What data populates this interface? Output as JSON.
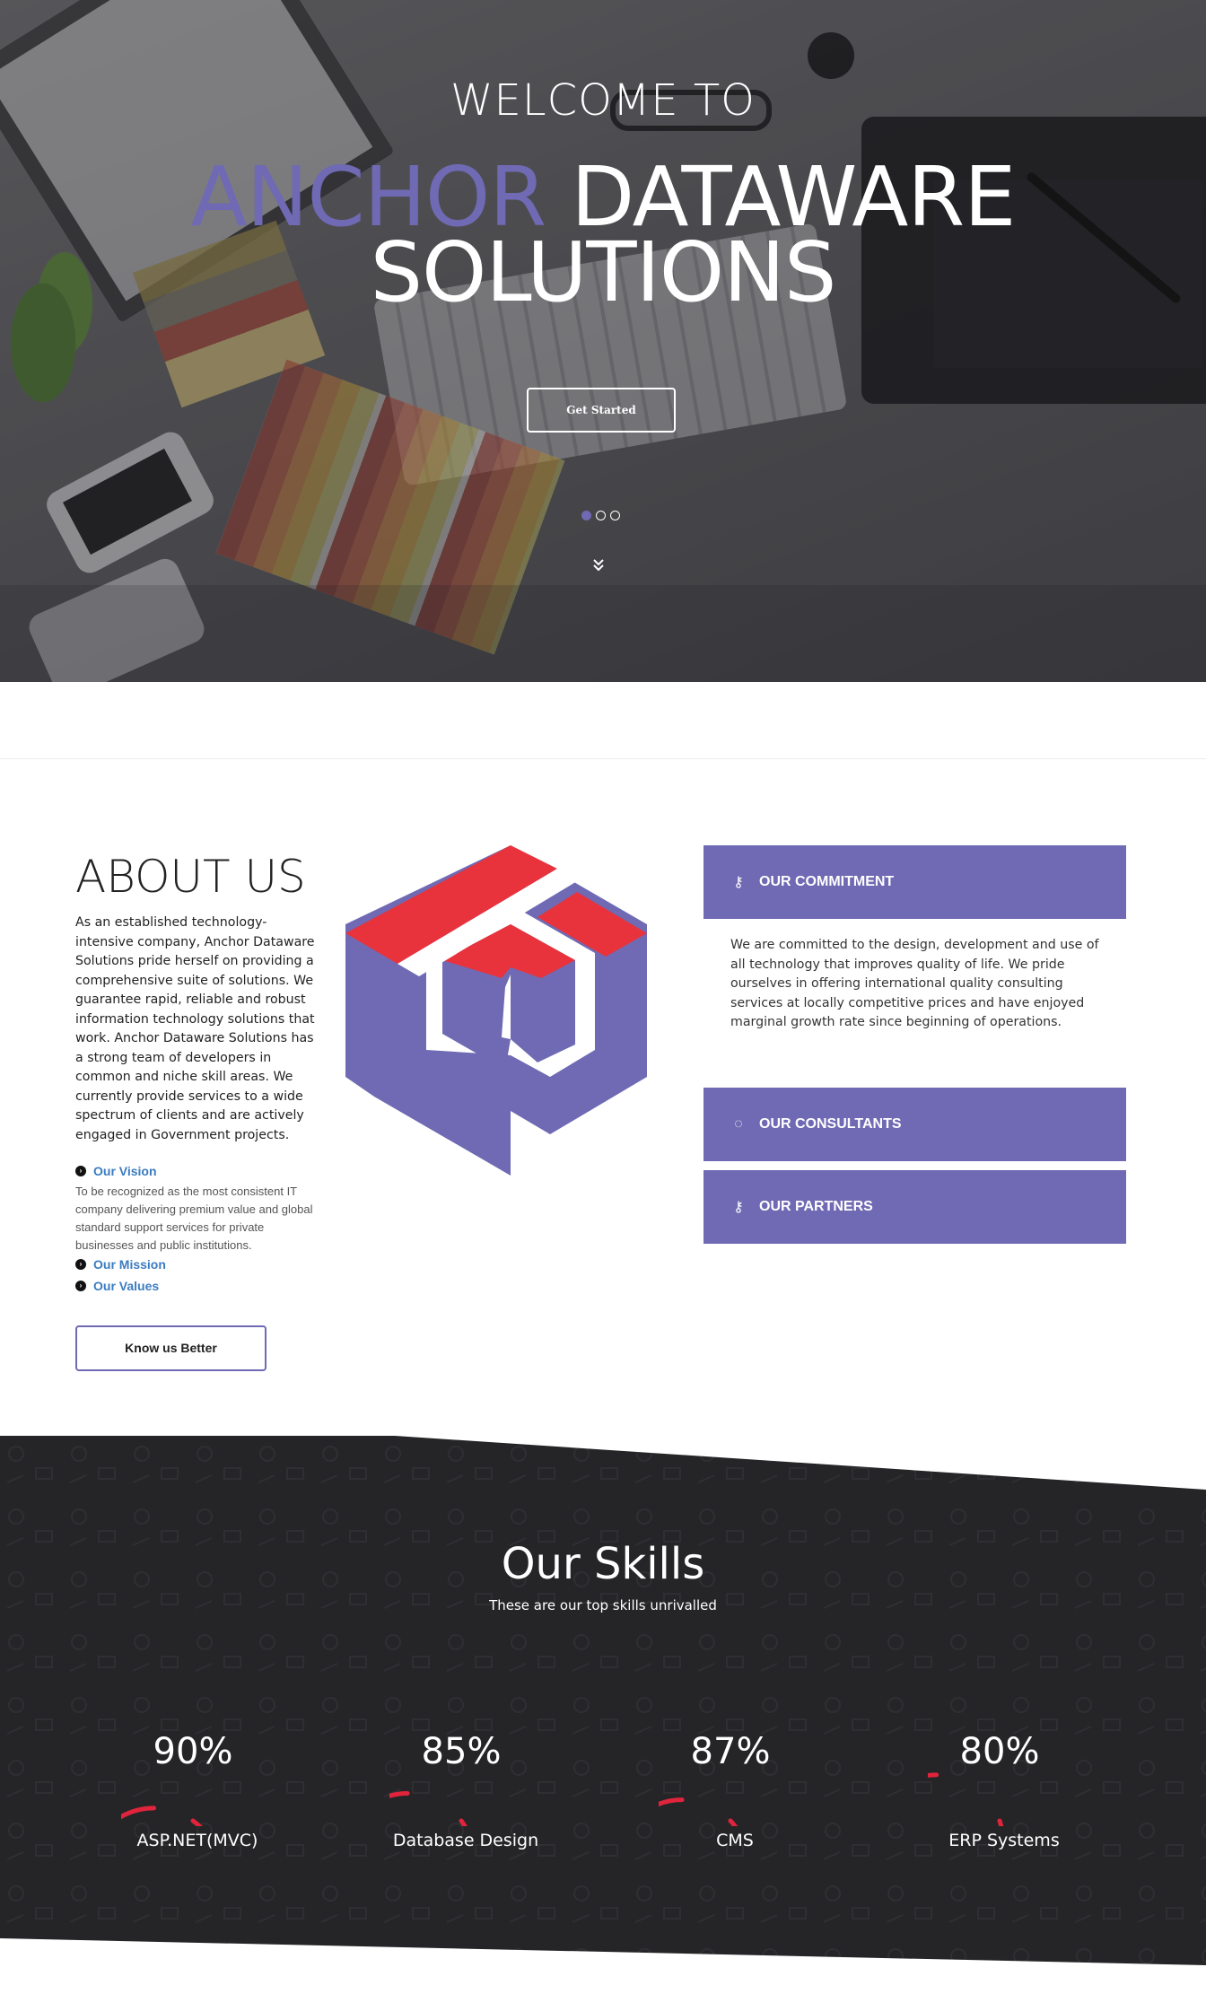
{
  "hero": {
    "welcome": "WELCOME TO",
    "title_accent": "ANCHOR",
    "title_rest": "DATAWARE",
    "title_line2": "SOLUTIONS",
    "cta_label": "Get Started",
    "accent_color": "#6f6ab3",
    "slides_total": 3,
    "slide_active": 1
  },
  "about": {
    "title": "ABOUT US",
    "body": "As an established technology-intensive company, Anchor Dataware Solutions pride herself on providing a comprehensive suite of solutions. We guarantee rapid, reliable and robust information technology solutions that work. Anchor Dataware Solutions has a strong team of developers in common and niche skill areas. We currently provide services to a wide spectrum of clients and are actively engaged in Government projects.",
    "vision_label": "Our Vision",
    "vision_text": "To be recognized as the most consistent IT company delivering premium value and global standard support services for private businesses and public institutions.",
    "mission_label": "Our Mission",
    "values_label": "Our Values",
    "button_label": "Know us Better"
  },
  "panels": {
    "commitment_title": "OUR COMMITMENT",
    "commitment_body": "We are committed to the design, development and use of all technology that improves quality of life. We pride ourselves in offering international quality consulting services at locally competitive prices and have enjoyed marginal growth rate since beginning of operations.",
    "consultants_title": "OUR CONSULTANTS",
    "partners_title": "OUR PARTNERS",
    "panel_color": "#6f6ab3"
  },
  "skills": {
    "title": "Our Skills",
    "subtitle": "These are our top skills unrivalled",
    "ring_color": "#e0243c",
    "items": [
      {
        "pct": "90%",
        "value": 90,
        "label": "ASP.NET(MVC)"
      },
      {
        "pct": "85%",
        "value": 85,
        "label": "Database Design"
      },
      {
        "pct": "87%",
        "value": 87,
        "label": "CMS"
      },
      {
        "pct": "80%",
        "value": 80,
        "label": "ERP Systems"
      }
    ]
  },
  "logo": {
    "red": "#e8333c",
    "purple": "#6f6ab3"
  }
}
